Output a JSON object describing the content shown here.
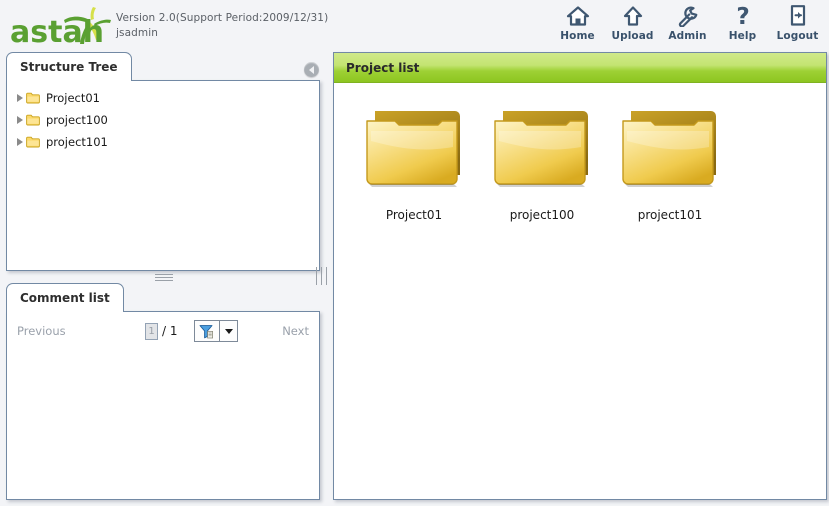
{
  "header": {
    "logo_text": "astah",
    "version": "Version 2.0(Support Period:2009/12/31)",
    "user": "jsadmin",
    "toolbar": [
      {
        "label": "Home",
        "icon": "home-icon"
      },
      {
        "label": "Upload",
        "icon": "upload-arrow-icon"
      },
      {
        "label": "Admin",
        "icon": "wrench-icon"
      },
      {
        "label": "Help",
        "icon": "question-mark-icon"
      },
      {
        "label": "Logout",
        "icon": "exit-door-icon"
      }
    ]
  },
  "structure_tree": {
    "tab_label": "Structure Tree",
    "collapse_icon": "chevron-left-circle-icon",
    "items": [
      {
        "label": "Project01",
        "icon": "folder-icon",
        "expander": "triangle-right-icon"
      },
      {
        "label": "project100",
        "icon": "folder-icon",
        "expander": "triangle-right-icon"
      },
      {
        "label": "project101",
        "icon": "folder-icon",
        "expander": "triangle-right-icon"
      }
    ]
  },
  "comment_list": {
    "tab_label": "Comment list",
    "previous_label": "Previous",
    "next_label": "Next",
    "page_value": "1",
    "page_total": "/ 1",
    "filter_icon": "funnel-filter-icon",
    "filter_menu_icon": "chevron-down-icon"
  },
  "project_list": {
    "header_title": "Project list",
    "items": [
      {
        "name": "Project01",
        "icon": "folder-large-icon"
      },
      {
        "name": "project100",
        "icon": "folder-large-icon"
      },
      {
        "name": "project101",
        "icon": "folder-large-icon"
      }
    ]
  },
  "colors": {
    "page_background": "#f3f4f7",
    "panel_border": "#7289a4",
    "header_green_light": "#d0e98a",
    "header_green_dark": "#8dc520",
    "logo_green": "#5aa032",
    "logo_lime": "#d6e04a",
    "toolbar_text": "#39516b",
    "folder_yellow": "#f4dd7e",
    "folder_yellow_dark": "#c9a21c"
  }
}
